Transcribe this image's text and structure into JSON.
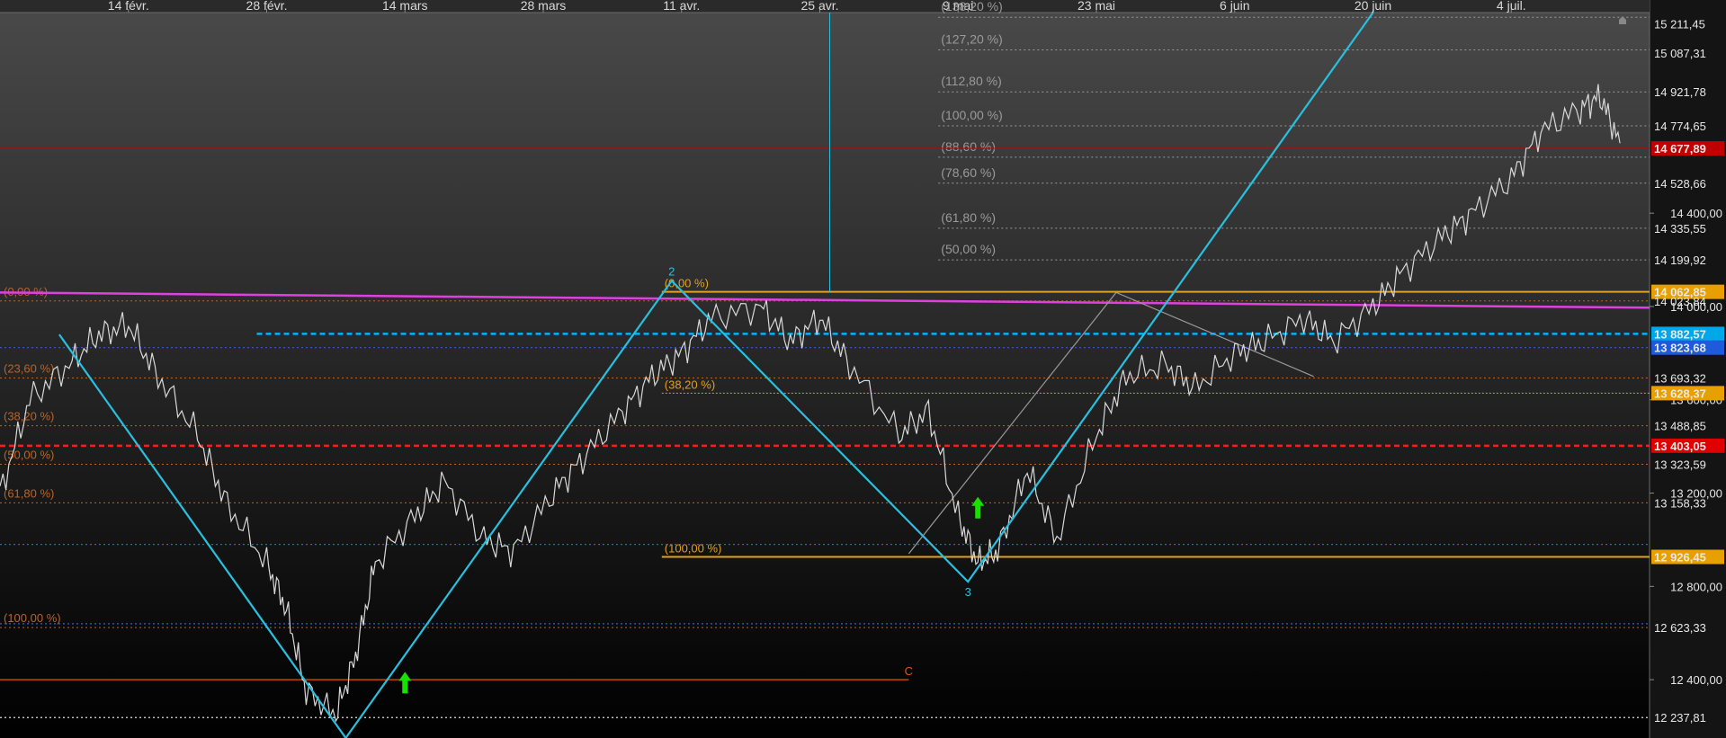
{
  "chart_data": {
    "type": "line",
    "title": "",
    "xlabel": "",
    "ylabel": "",
    "x_ticks": [
      "14 févr.",
      "28 févr.",
      "14 mars",
      "28 mars",
      "11 avr.",
      "25 avr.",
      "9 mai",
      "23 mai",
      "6 juin",
      "20 juin",
      "4 juil."
    ],
    "x_range": [
      "2022-02-01",
      "2022-07-18"
    ],
    "ylim": [
      12150,
      15260
    ],
    "y_ticks": [
      12400,
      12800,
      13200,
      13600,
      14000,
      14400
    ],
    "y_tick_labels": [
      "12 400,00",
      "12 800,00",
      "13 200,00",
      "13 600,00",
      "14 000,00",
      "14 400,00"
    ],
    "price_series": {
      "name": "",
      "color": "#d8d8d8",
      "x": [
        "2022-02-01",
        "2022-02-04",
        "2022-02-08",
        "2022-02-11",
        "2022-02-14",
        "2022-02-17",
        "2022-02-21",
        "2022-02-24",
        "2022-02-28",
        "2022-03-02",
        "2022-03-04",
        "2022-03-07",
        "2022-03-09",
        "2022-03-11",
        "2022-03-15",
        "2022-03-18",
        "2022-03-22",
        "2022-03-25",
        "2022-03-29",
        "2022-04-01",
        "2022-04-05",
        "2022-04-08",
        "2022-04-11",
        "2022-04-14",
        "2022-04-19",
        "2022-04-22",
        "2022-04-25",
        "2022-04-28",
        "2022-05-03",
        "2022-05-06",
        "2022-05-09",
        "2022-05-11",
        "2022-05-13",
        "2022-05-16",
        "2022-05-19",
        "2022-05-23",
        "2022-05-26",
        "2022-05-30",
        "2022-06-02",
        "2022-06-06",
        "2022-06-09",
        "2022-06-13",
        "2022-06-16",
        "2022-06-20",
        "2022-06-23",
        "2022-06-27",
        "2022-06-30",
        "2022-07-04",
        "2022-07-07",
        "2022-07-11",
        "2022-07-13",
        "2022-07-15"
      ],
      "y": [
        13200,
        13600,
        13750,
        13880,
        13920,
        13700,
        13450,
        13150,
        12900,
        12700,
        12350,
        12250,
        12500,
        12900,
        13100,
        13250,
        13000,
        12950,
        13200,
        13350,
        13550,
        13700,
        13800,
        13950,
        14000,
        13850,
        13950,
        13750,
        13450,
        13550,
        13100,
        12900,
        12950,
        13300,
        13000,
        13450,
        13700,
        13750,
        13650,
        13800,
        13850,
        13950,
        13850,
        14000,
        14150,
        14300,
        14400,
        14550,
        14750,
        14850,
        14900,
        14700
      ]
    },
    "right_axis_labels": [
      {
        "value": 15211.45,
        "text": "15 211,45",
        "bg": "",
        "color": "#e6e6e6"
      },
      {
        "value": 15087.31,
        "text": "15 087,31",
        "bg": "",
        "color": "#e6e6e6"
      },
      {
        "value": 14921.78,
        "text": "14 921,78",
        "bg": "",
        "color": "#e6e6e6"
      },
      {
        "value": 14774.65,
        "text": "14 774,65",
        "bg": "",
        "color": "#e6e6e6"
      },
      {
        "value": 14677.89,
        "text": "14 677,89",
        "bg": "#c00000",
        "color": "#ffffff"
      },
      {
        "value": 14528.66,
        "text": "14 528,66",
        "bg": "",
        "color": "#e6e6e6"
      },
      {
        "value": 14335.55,
        "text": "14 335,55",
        "bg": "",
        "color": "#e6e6e6"
      },
      {
        "value": 14199.92,
        "text": "14 199,92",
        "bg": "",
        "color": "#e6e6e6"
      },
      {
        "value": 14062.85,
        "text": "14 062,85",
        "bg": "#e8a000",
        "color": "#000000"
      },
      {
        "value": 14023.84,
        "text": "14 023,84",
        "bg": "",
        "color": "#ff8c40"
      },
      {
        "value": 13882.57,
        "text": "13 882,57",
        "bg": "#00a8e8",
        "color": "#000000"
      },
      {
        "value": 13823.68,
        "text": "13 823,68",
        "bg": "#1e5adc",
        "color": "#000000"
      },
      {
        "value": 13693.32,
        "text": "13 693,32",
        "bg": "",
        "color": "#ff8c40"
      },
      {
        "value": 13628.37,
        "text": "13 628,37",
        "bg": "#e8a000",
        "color": "#000000"
      },
      {
        "value": 13488.85,
        "text": "13 488,85",
        "bg": "",
        "color": "#ff8c40"
      },
      {
        "value": 13403.05,
        "text": "13 403,05",
        "bg": "#e00000",
        "color": "#ffffff"
      },
      {
        "value": 13323.59,
        "text": "13 323,59",
        "bg": "",
        "color": "#ff8c40"
      },
      {
        "value": 13158.33,
        "text": "13 158,33",
        "bg": "",
        "color": "#ff8c40"
      },
      {
        "value": 12926.45,
        "text": "12 926,45",
        "bg": "#e8a000",
        "color": "#000000"
      },
      {
        "value": 12623.33,
        "text": "12 623,33",
        "bg": "",
        "color": "#ff8c40"
      },
      {
        "value": 12237.81,
        "text": "12 237,81",
        "bg": "",
        "color": "#e6e6e6"
      }
    ],
    "fib_right": {
      "color": "#9a9a9a",
      "x_start": "2022-05-07",
      "levels": [
        {
          "label": "(138,20 %)",
          "value": 15240
        },
        {
          "label": "(127,20 %)",
          "value": 15100
        },
        {
          "label": "(112,80 %)",
          "value": 14920
        },
        {
          "label": "(100,00 %)",
          "value": 14774.65
        },
        {
          "label": "(88,60 %)",
          "value": 14640
        },
        {
          "label": "(78,60 %)",
          "value": 14528.66
        },
        {
          "label": "(61,80 %)",
          "value": 14335.55
        },
        {
          "label": "(50,00 %)",
          "value": 14199.92
        }
      ]
    },
    "fib_left": {
      "color": "#b8642a",
      "x_start": "2022-02-01",
      "levels": [
        {
          "label": "(0,00 %)",
          "value": 14023.84
        },
        {
          "label": "(23,60 %)",
          "value": 13693.32
        },
        {
          "label": "(38,20 %)",
          "value": 13488.85
        },
        {
          "label": "(50,00 %)",
          "value": 13323.59
        },
        {
          "label": "(61,80 %)",
          "value": 13158.33
        },
        {
          "label": "(100,00 %)",
          "value": 12623.33
        }
      ]
    },
    "fib_mid": {
      "color": "#e0a020",
      "x_start": "2022-04-09",
      "levels": [
        {
          "label": "(0,00 %)",
          "value": 14062.85
        },
        {
          "label": "(38,20 %)",
          "value": 13628.37
        },
        {
          "label": "(100,00 %)",
          "value": 12926.45
        }
      ]
    },
    "horizontal_lines": [
      {
        "value": 14677.89,
        "color": "#cc0000",
        "style": "solid"
      },
      {
        "value": 13882.57,
        "color": "#00b4ff",
        "style": "dashed",
        "x_start": "2022-02-27"
      },
      {
        "value": 13823.68,
        "color": "#2a5fe0",
        "style": "dotted"
      },
      {
        "value": 13403.05,
        "color": "#ff1a1a",
        "style": "dashed"
      },
      {
        "value": 12980,
        "color": "#2a5fe0",
        "style": "dotted"
      },
      {
        "value": 12640,
        "color": "#2a5fe0",
        "style": "dotted"
      },
      {
        "value": 12400,
        "color": "#e85010",
        "style": "solid",
        "x_end": "2022-05-04"
      },
      {
        "value": 12237.81,
        "color": "#dddddd",
        "style": "dotted"
      }
    ],
    "trend_lines": [
      {
        "name": "magenta",
        "color": "#e040e0",
        "points": [
          [
            "2022-02-01",
            14060
          ],
          [
            "2022-07-18",
            13995
          ]
        ]
      },
      {
        "name": "gray-up",
        "color": "#9a9a9a",
        "points": [
          [
            "2022-05-04",
            12940
          ],
          [
            "2022-05-25",
            14060
          ]
        ]
      },
      {
        "name": "gray-down",
        "color": "#9a9a9a",
        "points": [
          [
            "2022-05-25",
            14060
          ],
          [
            "2022-06-14",
            13700
          ]
        ]
      }
    ],
    "zigzag": {
      "color": "#29c0e0",
      "points": [
        [
          "2022-02-07",
          13880
        ],
        [
          "2022-03-08",
          12150
        ],
        [
          "2022-04-10",
          14110
        ],
        [
          "2022-05-10",
          12820
        ],
        [
          "2022-06-20",
          15260
        ]
      ],
      "labels": [
        {
          "text": "2",
          "point_index": 2
        },
        {
          "text": "3",
          "point_index": 3
        }
      ]
    },
    "markers": [
      {
        "type": "arrow-up",
        "color": "#19e000",
        "x": "2022-03-14",
        "value": 12380
      },
      {
        "type": "arrow-up",
        "color": "#19e000",
        "x": "2022-05-11",
        "value": 13130
      },
      {
        "type": "text",
        "text": "C",
        "color": "#e85010",
        "x": "2022-05-04",
        "value": 12420
      }
    ],
    "vertical_line": {
      "x": "2022-04-26",
      "color": "#29c0e0"
    }
  }
}
